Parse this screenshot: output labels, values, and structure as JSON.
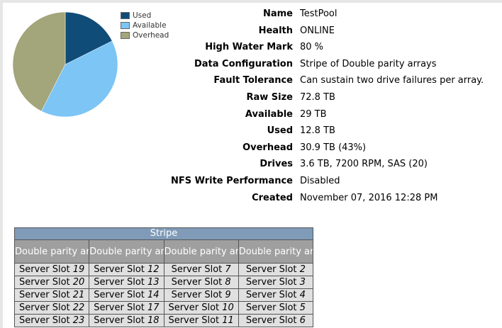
{
  "pie": {
    "legend": [
      {
        "label": "Used",
        "color": "#0f4c78"
      },
      {
        "label": "Available",
        "color": "#7cc5f5"
      },
      {
        "label": "Overhead",
        "color": "#a3a57a"
      }
    ],
    "values": [
      12.8,
      29,
      30.9
    ]
  },
  "info": {
    "name_label": "Name",
    "name_value": "TestPool",
    "health_label": "Health",
    "health_value": "ONLINE",
    "hwm_label": "High Water Mark",
    "hwm_value": "80 %",
    "dataconf_label": "Data Configuration",
    "dataconf_value": "Stripe of Double parity arrays",
    "fault_label": "Fault Tolerance",
    "fault_value": "Can sustain two drive failures per array.",
    "rawsize_label": "Raw Size",
    "rawsize_value": "72.8 TB",
    "available_label": "Available",
    "available_value": "29 TB",
    "used_label": "Used",
    "used_value": "12.8 TB",
    "overhead_label": "Overhead",
    "overhead_value": "30.9 TB (43%)",
    "drives_label": "Drives",
    "drives_value": "3.6 TB, 7200 RPM, SAS (20)",
    "nfs_label": "NFS Write Performance",
    "nfs_value": "Disabled",
    "created_label": "Created",
    "created_value": "November 07, 2016 12:28 PM"
  },
  "stripe": {
    "title": "Stripe",
    "columns": [
      "Double parity array",
      "Double parity array",
      "Double parity array",
      "Double parity array"
    ],
    "slot_prefix": "Server Slot",
    "rows": [
      [
        "19",
        "12",
        "7",
        "2"
      ],
      [
        "20",
        "13",
        "8",
        "3"
      ],
      [
        "21",
        "14",
        "9",
        "4"
      ],
      [
        "22",
        "17",
        "10",
        "5"
      ],
      [
        "23",
        "18",
        "11",
        "6"
      ]
    ]
  }
}
